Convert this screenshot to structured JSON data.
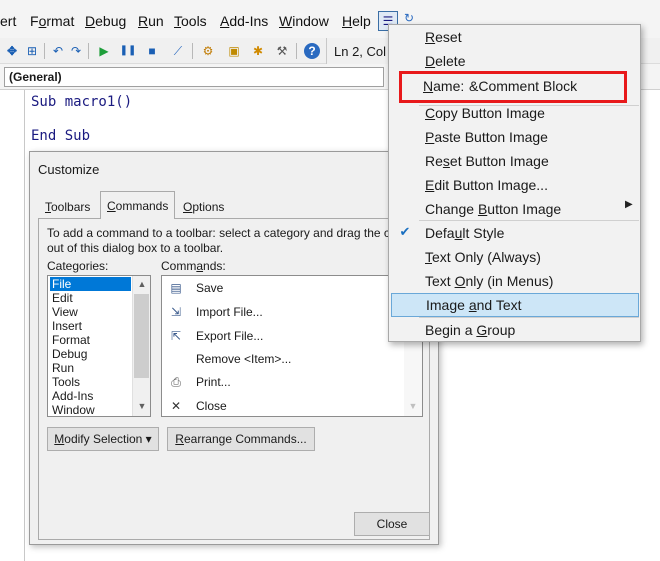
{
  "menubar": {
    "items": [
      {
        "label": "ert"
      },
      {
        "label": "Format",
        "ul": "o"
      },
      {
        "label": "Debug",
        "ul": "D"
      },
      {
        "label": "Run",
        "ul": "R"
      },
      {
        "label": "Tools",
        "ul": "T"
      },
      {
        "label": "Add-Ins",
        "ul": "A"
      },
      {
        "label": "Window",
        "ul": "W"
      },
      {
        "label": "Help",
        "ul": "H"
      }
    ]
  },
  "toolbar": {
    "position": "Ln 2, Col"
  },
  "general_combo": "(General)",
  "code": {
    "lines": [
      "Sub macro1()",
      "",
      "End Sub"
    ]
  },
  "dialog": {
    "title": "Customize",
    "tabs": [
      "Toolbars",
      "Commands",
      "Options"
    ],
    "active_tab": "Commands",
    "instruction_line1": "To add a command to a toolbar: select a category and drag the com",
    "instruction_line2": "out of this dialog box to a toolbar.",
    "categories_label": "Categories:",
    "commands_label": "Commands:",
    "categories": [
      "File",
      "Edit",
      "View",
      "Insert",
      "Format",
      "Debug",
      "Run",
      "Tools",
      "Add-Ins",
      "Window"
    ],
    "selected_category": "File",
    "commands": [
      {
        "label": "Save",
        "icon": "save-icon",
        "glyph": "💾"
      },
      {
        "label": "Import File...",
        "icon": "import-file-icon",
        "glyph": "⇲"
      },
      {
        "label": "Export File...",
        "icon": "export-file-icon",
        "glyph": "⇱"
      },
      {
        "label": "Remove <Item>...",
        "icon": "",
        "glyph": ""
      },
      {
        "label": "Print...",
        "icon": "print-icon",
        "glyph": "⎙"
      },
      {
        "label": "Close",
        "icon": "close-icon",
        "glyph": "✕"
      }
    ],
    "modify_selection_label": "Modify Selection ▾",
    "rearrange_label": "Rearrange Commands...",
    "close_label": "Close"
  },
  "context_menu": {
    "reset": "Reset",
    "delete": "Delete",
    "name_label": "Name:",
    "name_value": "&Comment Block",
    "copy_button_image": "Copy Button Image",
    "paste_button_image": "Paste Button Image",
    "reset_button_image": "Reset Button Image",
    "edit_button_image": "Edit Button Image...",
    "change_button_image": "Change Button Image",
    "default_style": "Default Style",
    "text_only_always": "Text Only (Always)",
    "text_only_menus": "Text Only (in Menus)",
    "image_and_text": "Image and Text",
    "begin_group": "Begin a Group",
    "highlighted_item": "Image and Text",
    "checked_item": "Default Style"
  },
  "colors": {
    "selection_blue": "#0078d7",
    "highlight_red": "#e8191b",
    "menu_highlight": "#cde6f7"
  }
}
